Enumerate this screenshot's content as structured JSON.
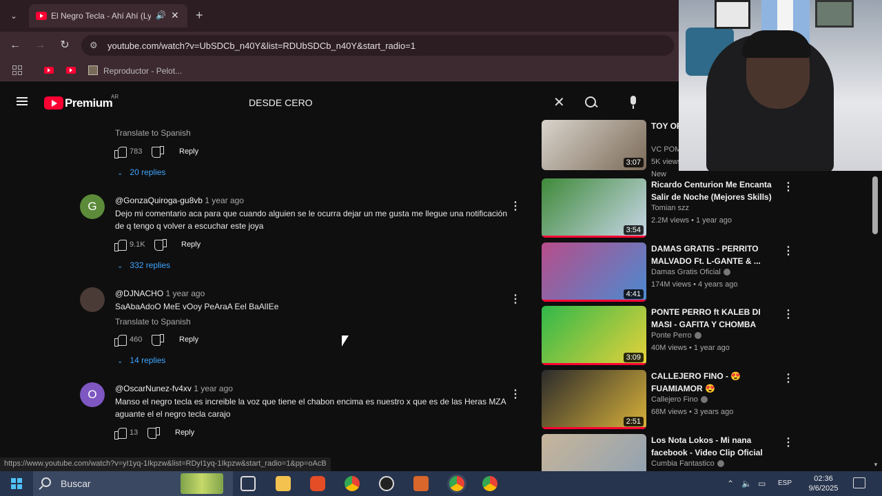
{
  "browser": {
    "tab_title": "El Negro Tecla - Ahí Ahí (Lyric",
    "tab_close": "✕",
    "new_tab": "+",
    "url": "youtube.com/watch?v=UbSDCb_n40Y&list=RDUbSDCb_n40Y&start_radio=1",
    "bookmark_pelota": "Reproductor - Pelot...",
    "status_url": "https://www.youtube.com/watch?v=yI1yq-1Ikpzw&list=RDyI1yq-1Ikpzw&start_radio=1&pp=oAcB"
  },
  "yt_header": {
    "brand": "Premium",
    "region": "AR",
    "search_query": "DESDE CERO",
    "clear": "✕"
  },
  "comments": {
    "top_translate": "Translate to Spanish",
    "top_likes": "783",
    "top_reply": "Reply",
    "top_replies": "20 replies",
    "items": [
      {
        "avatar_letter": "G",
        "avatar_color": "#5c8b3a",
        "author": "@GonzaQuiroga-gu8vb",
        "time": "1 year ago",
        "text": "Dejo mi comentario aca para que cuando alguien se le ocurra dejar un me gusta me llegue una notificación de q tengo q volver a escuchar este joya",
        "likes": "9.1K",
        "reply": "Reply",
        "replies": "332 replies"
      },
      {
        "avatar_letter": "",
        "avatar_color": "#4a3b36",
        "author": "@DJNACHO",
        "time": "1 year ago",
        "text": "SaAbaAdoO MeE vOoy PeAraA Eel BaAlIEe",
        "translate": "Translate to Spanish",
        "likes": "460",
        "reply": "Reply",
        "replies": "14 replies"
      },
      {
        "avatar_letter": "O",
        "avatar_color": "#7e57c2",
        "author": "@OscarNunez-fv4xv",
        "time": "1 year ago",
        "text": "Manso el negro tecla es increible la voz que tiene el chabon encima es nuestro x que es de las Heras MZA aguante el el negro tecla carajo",
        "likes": "13",
        "reply": "Reply"
      }
    ]
  },
  "related": [
    {
      "title": "TOY OFICIAL",
      "channel": "VC POM",
      "meta": "5K views",
      "badge": "New",
      "duration": "3:07",
      "colors": [
        "#d9d4cc",
        "#7b6a58"
      ]
    },
    {
      "title": "Ricardo Centurion Me Encanta Salir de Noche (Mejores Skills)",
      "channel": "Tomian szz",
      "meta": "2.2M views • 1 year ago",
      "duration": "3:54",
      "colors": [
        "#3f8a3a",
        "#c9d7e8"
      ]
    },
    {
      "title": "DAMAS GRATIS - PERRITO MALVADO Ft. L-GANTE & ...",
      "channel": "Damas Gratis Oficial",
      "meta": "174M views • 4 years ago",
      "duration": "4:41",
      "colors": [
        "#b84d8a",
        "#4a8bd1"
      ]
    },
    {
      "title": "PONTE PERRO ft KALEB DI MASI - GAFITA Y CHOMBA",
      "channel": "Ponte Perro",
      "meta": "40M views • 1 year ago",
      "duration": "3:09",
      "colors": [
        "#2fb84a",
        "#e8d23a"
      ]
    },
    {
      "title": "CALLEJERO FINO - 😍 FUAMIAMOR 😍",
      "channel": "Callejero Fino",
      "meta": "68M views • 3 years ago",
      "duration": "2:51",
      "colors": [
        "#2b2b2b",
        "#d9b23a"
      ]
    },
    {
      "title": "Los Nota Lokos - Mi nana facebook - Video Clip Oficial",
      "channel": "Cumbia Fantastico",
      "meta": "",
      "duration": "",
      "colors": [
        "#c8b59a",
        "#8aa0b4"
      ]
    }
  ],
  "taskbar": {
    "search_label": "Buscar",
    "lang": "ESP",
    "time": "02:36",
    "date": "9/6/2025"
  },
  "icons": {
    "like": "like-icon",
    "dislike": "dislike-icon",
    "kebab": "⋮",
    "chevron": "⌄"
  }
}
